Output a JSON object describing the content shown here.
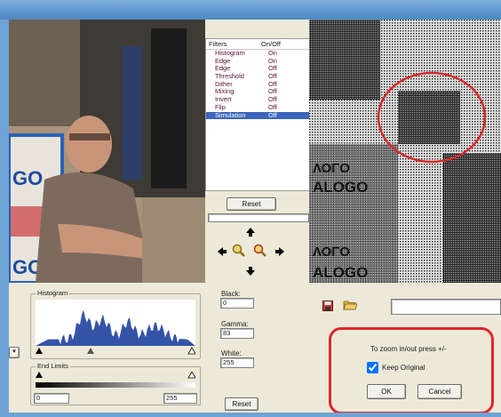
{
  "filters": {
    "header_name": "Filters",
    "header_state": "On/Off",
    "items": [
      {
        "name": "Histogram",
        "state": "On"
      },
      {
        "name": "Edge",
        "state": "On"
      },
      {
        "name": "Edge",
        "state": "Off"
      },
      {
        "name": "Threshold",
        "state": "Off"
      },
      {
        "name": "Dither",
        "state": "Off"
      },
      {
        "name": "Mixing",
        "state": "Off"
      },
      {
        "name": "Invert",
        "state": "Off"
      },
      {
        "name": "Flip",
        "state": "Off"
      },
      {
        "name": "Simulation",
        "state": "Off"
      }
    ],
    "selected_index": 8,
    "reset_label": "Reset"
  },
  "nav": {
    "icons": [
      "arrow-up-icon",
      "arrow-down-icon",
      "arrow-left-icon",
      "arrow-right-icon",
      "zoom-in-icon",
      "zoom-out-icon"
    ]
  },
  "histogram": {
    "group_label": "Histogram",
    "fill_color": "#3454a8",
    "end_limits_label": "End Limits",
    "end_low": "0",
    "end_high": "255"
  },
  "levels": {
    "black_label": "Black:",
    "black_value": "0",
    "gamma_label": "Gamma:",
    "gamma_value": "83",
    "white_label": "White:",
    "white_value": "255",
    "reset_label": "Reset"
  },
  "toolbar": {
    "icons": [
      "save-icon",
      "open-folder-icon"
    ]
  },
  "zoom_panel": {
    "hint": "To zoom in/out press +/-",
    "keep_original_label": "Keep Original",
    "keep_original_checked": true,
    "ok_label": "OK",
    "cancel_label": "Cancel",
    "highlight_color": "#e3262a"
  },
  "photo": {
    "sign_text_1": "GO",
    "sign_text_2": "GO",
    "processed_text_1": "ΛΟΓΟ",
    "processed_text_2": "ALOGO",
    "processed_text_3": "ΛΟΓΟ",
    "processed_text_4": "ALOGO"
  }
}
